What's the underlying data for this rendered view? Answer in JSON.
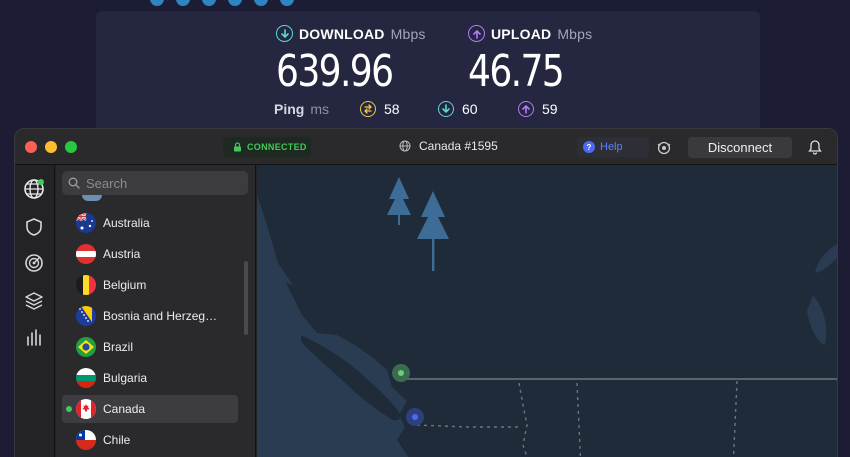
{
  "speedtest": {
    "download": {
      "label": "DOWNLOAD",
      "unit": "Mbps",
      "value": "639.96",
      "color": "#5fd8d0"
    },
    "upload": {
      "label": "UPLOAD",
      "unit": "Mbps",
      "value": "46.75",
      "color": "#b07cf7"
    },
    "ping": {
      "label": "Ping",
      "unit": "ms",
      "idle": "58",
      "download": "60",
      "upload": "59",
      "idle_color": "#f2c94c"
    }
  },
  "window": {
    "status": "CONNECTED",
    "server": "Canada #1595",
    "help_label": "Help",
    "disconnect_label": "Disconnect"
  },
  "sidebar": {
    "search_placeholder": "Search",
    "countries": [
      {
        "name": "Australia"
      },
      {
        "name": "Austria"
      },
      {
        "name": "Belgium"
      },
      {
        "name": "Bosnia and Herzeg…"
      },
      {
        "name": "Brazil"
      },
      {
        "name": "Bulgaria"
      },
      {
        "name": "Canada",
        "active": true
      },
      {
        "name": "Chile"
      }
    ]
  },
  "colors": {
    "accent_green": "#42c95b",
    "map_water": "#2a3c52",
    "map_land": "#1f2b38",
    "map_tree": "#3d6d96"
  }
}
